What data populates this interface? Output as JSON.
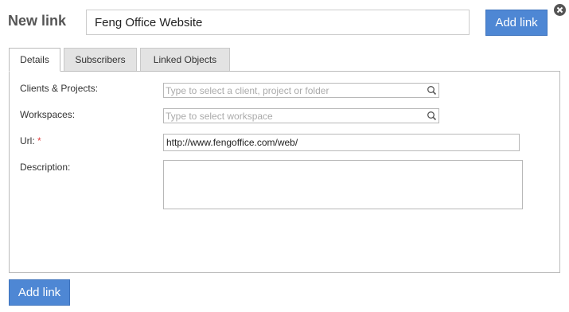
{
  "header": {
    "title": "New link",
    "title_input_value": "Feng Office Website",
    "add_link_label": "Add link",
    "close_icon": "close-icon"
  },
  "tabs": [
    {
      "label": "Details",
      "active": true
    },
    {
      "label": "Subscribers",
      "active": false
    },
    {
      "label": "Linked Objects",
      "active": false
    }
  ],
  "form": {
    "clients_projects": {
      "label": "Clients & Projects:",
      "placeholder": "Type to select a client, project or folder",
      "icon": "search-icon"
    },
    "workspaces": {
      "label": "Workspaces:",
      "placeholder": "Type to select workspace",
      "icon": "search-icon"
    },
    "url": {
      "label": "Url:",
      "required_marker": "*",
      "value": "http://www.fengoffice.com/web/"
    },
    "description": {
      "label": "Description:",
      "value": ""
    }
  },
  "footer": {
    "add_link_label": "Add link"
  },
  "colors": {
    "primary_button": "#4e87d4",
    "required": "#e04040",
    "tab_inactive": "#e3e3e3"
  }
}
